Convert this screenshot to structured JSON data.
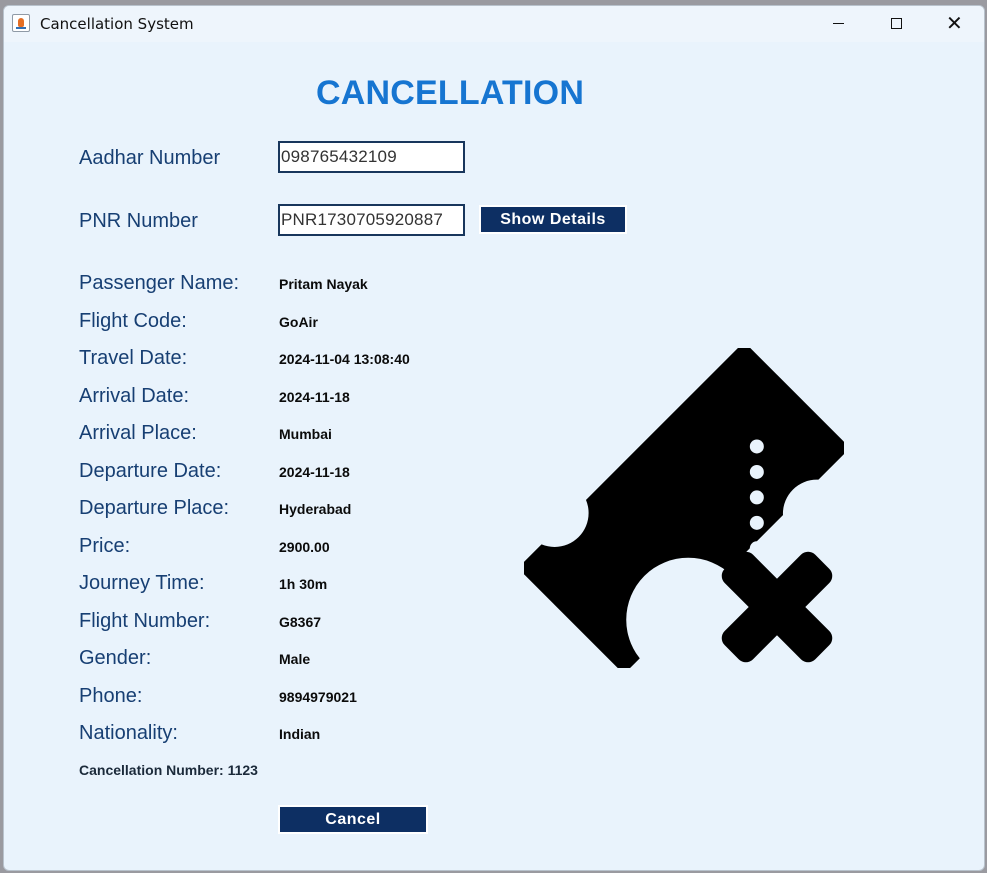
{
  "window": {
    "title": "Cancellation System",
    "controls": {
      "minimize": "minimize",
      "maximize": "maximize",
      "close": "✕"
    }
  },
  "form": {
    "heading": "CANCELLATION",
    "aadhar": {
      "label": "Aadhar Number",
      "value": "098765432109"
    },
    "pnr": {
      "label": "PNR Number",
      "value": "PNR1730705920887"
    },
    "show_details_button": "Show Details",
    "cancel_button": "Cancel"
  },
  "details": [
    {
      "label": "Passenger Name:",
      "value": "Pritam Nayak"
    },
    {
      "label": "Flight Code:",
      "value": "GoAir"
    },
    {
      "label": "Travel Date:",
      "value": "2024-11-04 13:08:40"
    },
    {
      "label": "Arrival Date:",
      "value": "2024-11-18"
    },
    {
      "label": "Arrival Place:",
      "value": "Mumbai"
    },
    {
      "label": "Departure Date:",
      "value": "2024-11-18"
    },
    {
      "label": "Departure Place:",
      "value": "Hyderabad"
    },
    {
      "label": "Price:",
      "value": "2900.00"
    },
    {
      "label": "Journey Time:",
      "value": "1h 30m"
    },
    {
      "label": "Flight Number:",
      "value": "G8367"
    },
    {
      "label": "Gender:",
      "value": "Male"
    },
    {
      "label": "Phone:",
      "value": "9894979021"
    },
    {
      "label": "Nationality:",
      "value": "Indian"
    }
  ],
  "cancellation_number": "Cancellation Number: 1123",
  "icons": {
    "app": "java-app-icon",
    "illustration": "ticket-cancel-icon"
  },
  "colors": {
    "heading": "#1675d1",
    "label": "#173f73",
    "button_bg": "#0d2f63",
    "window_bg": "#e9f3fc"
  }
}
